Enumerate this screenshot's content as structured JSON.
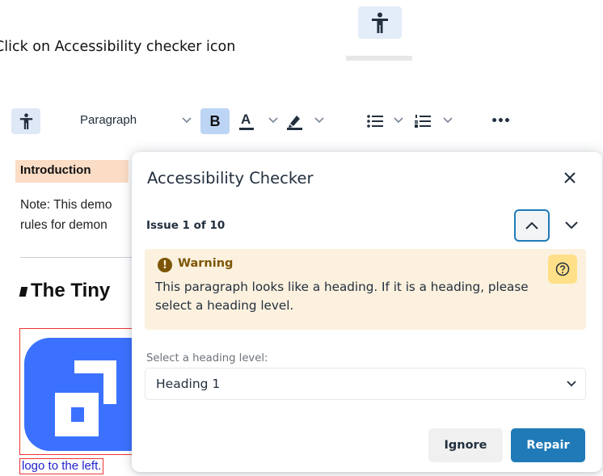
{
  "instruction": {
    "text": "Click on Accessibility checker icon",
    "icon": "accessibility-icon"
  },
  "toolbar": {
    "accessibility_icon": "accessibility-icon",
    "block_format": "Paragraph",
    "bold": "B",
    "text_color_label": "A",
    "highlight_icon": "highlighter-icon",
    "bullet_list_icon": "bullet-list-icon",
    "numbered_list_icon": "numbered-list-icon",
    "more": "•••"
  },
  "document": {
    "intro": "Introduction",
    "note_line1": "Note: This demo",
    "note_line2": "rules for demon",
    "heading": "The Tiny",
    "caption": "logo to the left."
  },
  "dialog": {
    "title": "Accessibility Checker",
    "close": "✕",
    "issue_count": "Issue 1 of 10",
    "warning": {
      "label": "Warning",
      "text": "This paragraph looks like a heading. If it is a heading, please select a heading level."
    },
    "select_label": "Select a heading level:",
    "select_value": "Heading 1",
    "ignore_label": "Ignore",
    "repair_label": "Repair"
  },
  "colors": {
    "accent": "#207ab7",
    "warning_bg": "#fcf1de",
    "warning_text": "#7d5506",
    "help_bg": "#ffe089",
    "logo_blue": "#3b71fe",
    "intro_highlight": "#fbdcc4"
  }
}
